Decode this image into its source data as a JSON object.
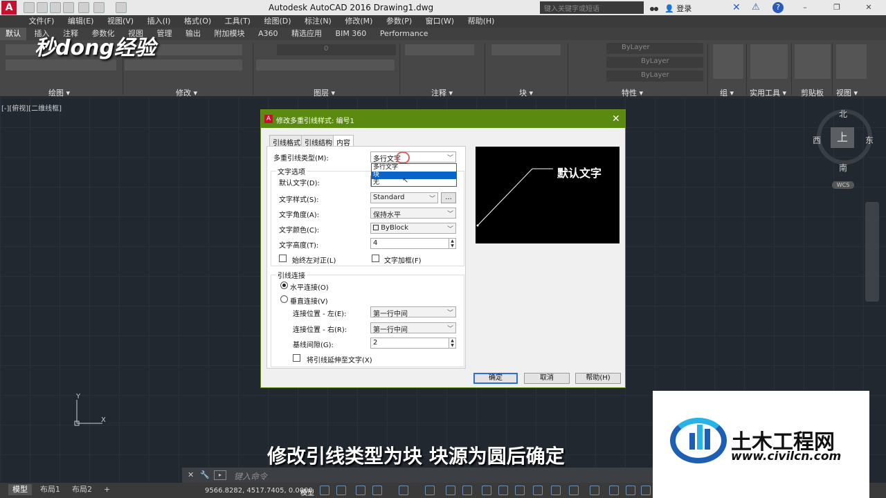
{
  "titlebar": {
    "app_logo": "A",
    "title": "Autodesk AutoCAD 2016    Drawing1.dwg",
    "search_placeholder": "键入关键字或短语",
    "login": "登录"
  },
  "menu": [
    "文件(F)",
    "编辑(E)",
    "视图(V)",
    "插入(I)",
    "格式(O)",
    "工具(T)",
    "绘图(D)",
    "标注(N)",
    "修改(M)",
    "参数(P)",
    "窗口(W)",
    "帮助(H)"
  ],
  "ribbon_tabs": [
    "默认",
    "插入",
    "注释",
    "参数化",
    "视图",
    "管理",
    "输出",
    "附加模块",
    "A360",
    "精选应用",
    "BIM 360",
    "Performance"
  ],
  "ribbon_panels": {
    "draw": "绘图 ▾",
    "modify": "修改 ▾",
    "layer": "图层 ▾",
    "annotation": "注释 ▾",
    "block": "块 ▾",
    "properties": "特性 ▾",
    "group": "组 ▾",
    "utilities": "实用工具 ▾",
    "clipboard": "剪贴板",
    "view": "视图 ▾",
    "bylayer_1": "ByLayer",
    "bylayer_2": "ByLayer",
    "bylayer_3": "ByLayer",
    "layer_zero": "0"
  },
  "watermark_logo": "秒dong经验",
  "viewport_label": "[-][俯视][二维线框]",
  "compass": {
    "north": "北",
    "south": "南",
    "east": "东",
    "west": "西",
    "top": "上",
    "wcs": "WCS"
  },
  "ucs": {
    "y": "Y",
    "x": "X"
  },
  "dialog": {
    "title": "修改多重引线样式: 编号1",
    "tabs": [
      "引线格式",
      "引线结构",
      "内容"
    ],
    "multileader_type_label": "多重引线类型(M):",
    "multileader_type_value": "多行文字",
    "dropdown_options": [
      "多行文字",
      "块",
      "无"
    ],
    "dropdown_selected_index": 1,
    "text_options_group": "文字选项",
    "default_text_label": "默认文字(D):",
    "text_style_label": "文字样式(S):",
    "text_style_value": "Standard",
    "ellipsis": "...",
    "text_angle_label": "文字角度(A):",
    "text_angle_value": "保持水平",
    "text_color_label": "文字颜色(C):",
    "text_color_value": "ByBlock",
    "text_height_label": "文字高度(T):",
    "text_height_value": "4",
    "always_left_label": "始终左对正(L)",
    "text_frame_label": "文字加框(F)",
    "leader_connection_group": "引线连接",
    "horizontal_label": "水平连接(O)",
    "vertical_label": "垂直连接(V)",
    "attach_left_label": "连接位置 - 左(E):",
    "attach_left_value": "第一行中间",
    "attach_right_label": "连接位置 - 右(R):",
    "attach_right_value": "第一行中间",
    "landing_gap_label": "基线间隙(G):",
    "landing_gap_value": "2",
    "extend_leader_label": "将引线延伸至文字(X)",
    "preview_text": "默认文字",
    "ok": "确定",
    "cancel": "取消",
    "help": "帮助(H)"
  },
  "subtitle": "修改引线类型为块 块源为圆后确定",
  "command_placeholder": "键入命令",
  "layout_tabs": [
    "模型",
    "布局1",
    "布局2"
  ],
  "add_layout": "+",
  "status": {
    "coords": "9566.8282, 4517.7405, 0.0000",
    "model": "模型"
  },
  "civil_watermark": {
    "name": "土木工程网",
    "url": "www.civilcn.com"
  }
}
